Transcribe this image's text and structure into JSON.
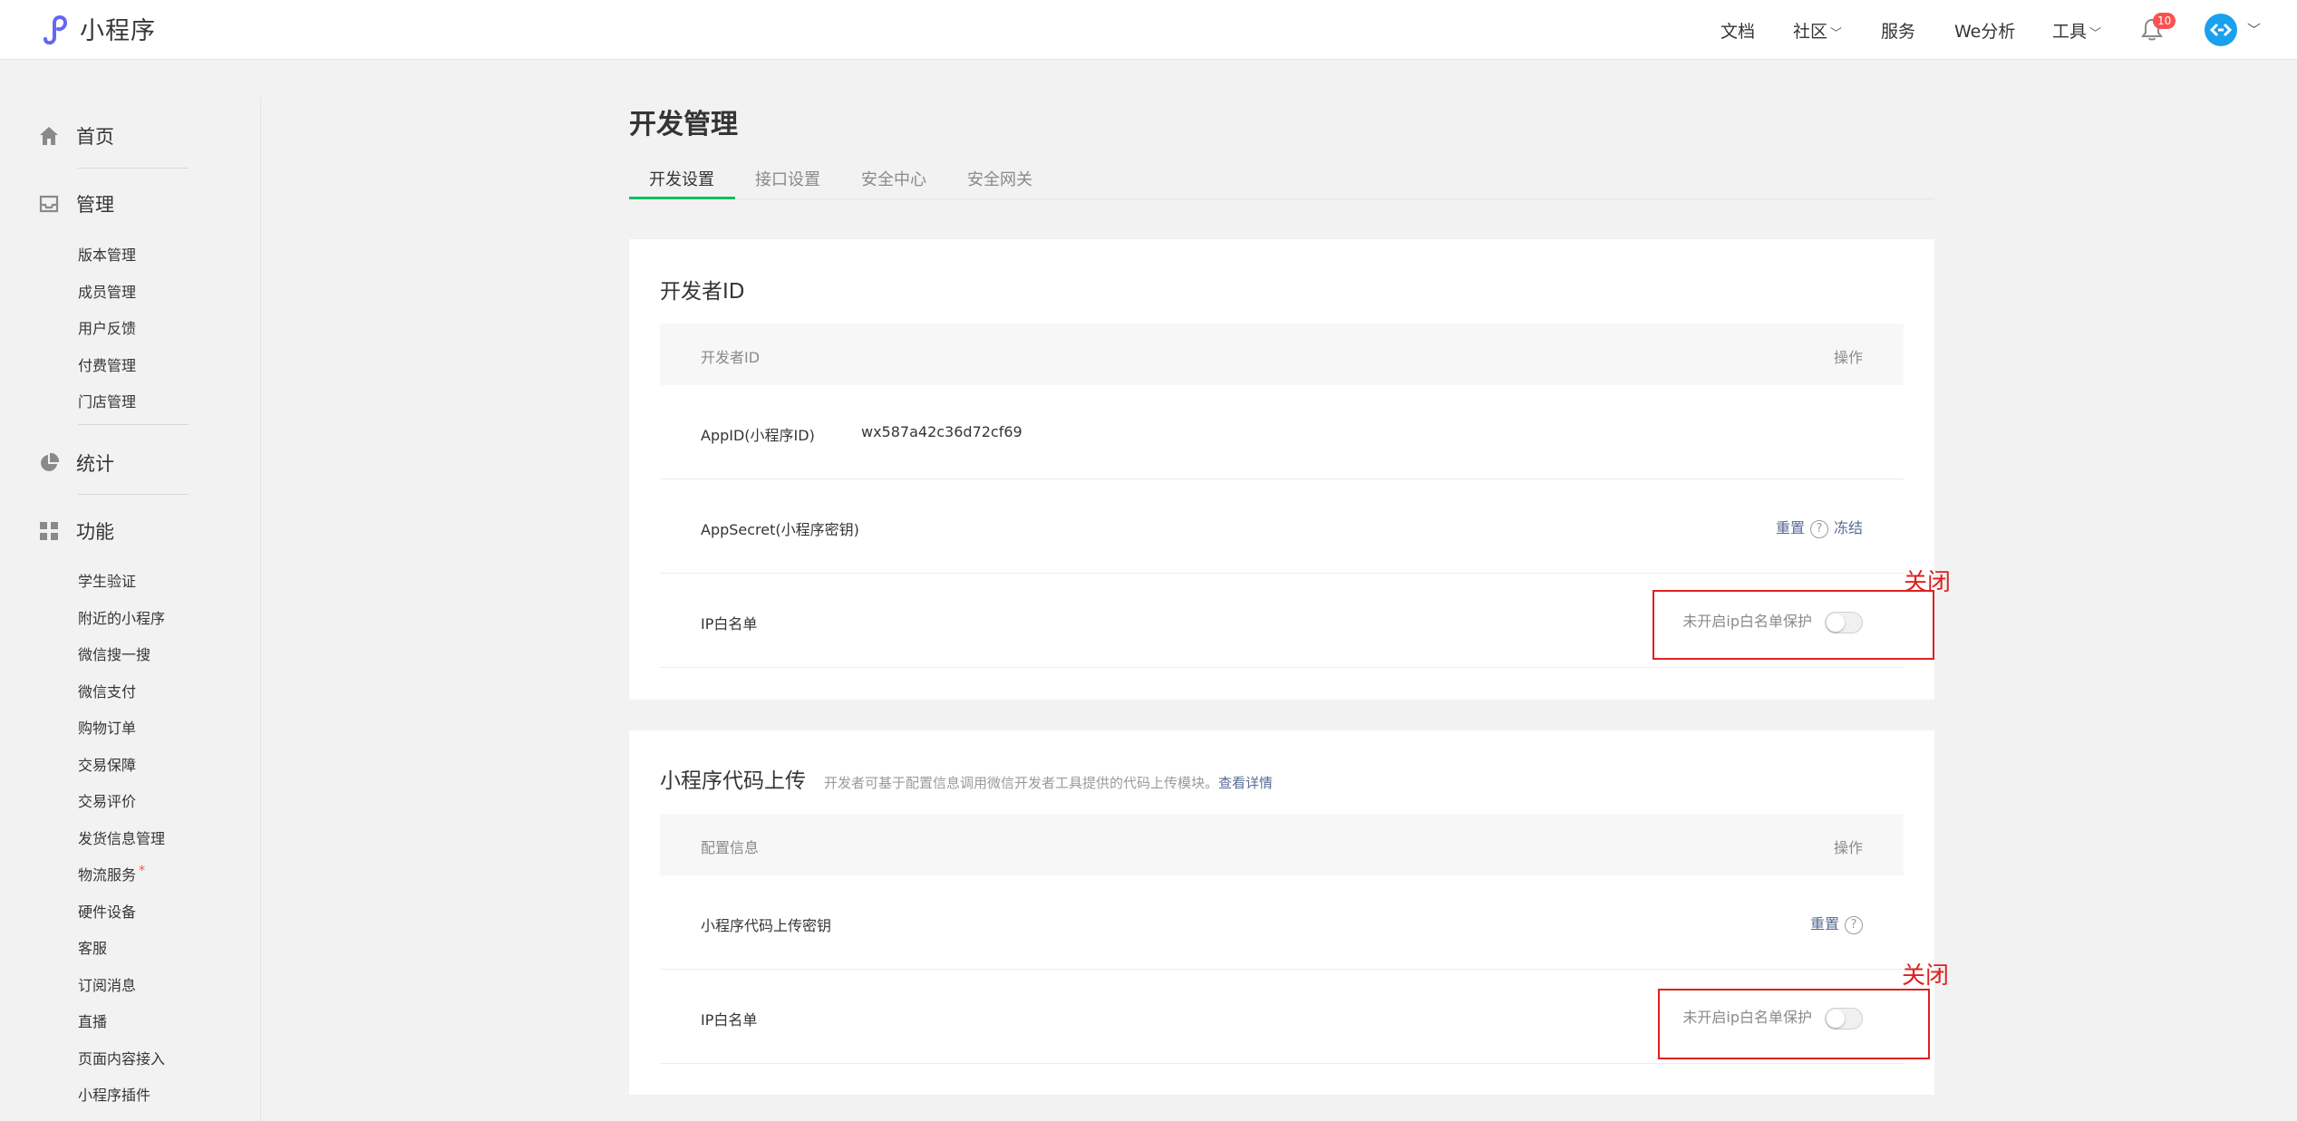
{
  "header": {
    "logo_text": "小程序",
    "nav": [
      {
        "label": "文档",
        "has_dropdown": false
      },
      {
        "label": "社区",
        "has_dropdown": true
      },
      {
        "label": "服务",
        "has_dropdown": false
      },
      {
        "label": "We分析",
        "has_dropdown": false
      },
      {
        "label": "工具",
        "has_dropdown": true
      }
    ],
    "notification_count": "10"
  },
  "sidebar": {
    "sections": [
      {
        "label": "首页",
        "icon": "home-icon",
        "items": []
      },
      {
        "label": "管理",
        "icon": "inbox-icon",
        "items": [
          "版本管理",
          "成员管理",
          "用户反馈",
          "付费管理",
          "门店管理"
        ]
      },
      {
        "label": "统计",
        "icon": "pie-chart-icon",
        "items": []
      },
      {
        "label": "功能",
        "icon": "grid-icon",
        "items": [
          "学生验证",
          "附近的小程序",
          "微信搜一搜",
          "微信支付",
          "购物订单",
          "交易保障",
          "交易评价",
          "发货信息管理",
          "物流服务",
          "硬件设备",
          "客服",
          "订阅消息",
          "直播",
          "页面内容接入",
          "小程序插件"
        ]
      }
    ],
    "dot_marker": "*"
  },
  "main": {
    "title": "开发管理",
    "tabs": [
      "开发设置",
      "接口设置",
      "安全中心",
      "安全网关"
    ],
    "active_tab": 0,
    "developer_card": {
      "title": "开发者ID",
      "col_left": "开发者ID",
      "col_right": "操作",
      "appid_label": "AppID(小程序ID)",
      "appid_value": "wx587a42c36d72cf69",
      "secret_label": "AppSecret(小程序密钥)",
      "reset_label": "重置",
      "help_glyph": "?",
      "freeze_label": "冻结",
      "ip_label": "IP白名单",
      "ip_status": "未开启ip白名单保护",
      "annotation": "关闭"
    },
    "upload_card": {
      "title": "小程序代码上传",
      "desc": "开发者可基于配置信息调用微信开发者工具提供的代码上传模块。",
      "desc_link": "查看详情",
      "col_left": "配置信息",
      "col_right": "操作",
      "key_label": "小程序代码上传密钥",
      "reset_label": "重置",
      "help_glyph": "?",
      "ip_label": "IP白名单",
      "ip_status": "未开启ip白名单保护",
      "annotation": "关闭"
    }
  },
  "colors": {
    "accent_green": "#07c160",
    "link_blue": "#576b95",
    "annotation_red": "#e0201f",
    "badge_red": "#fa5151",
    "avatar_blue": "#1aa1ee"
  }
}
